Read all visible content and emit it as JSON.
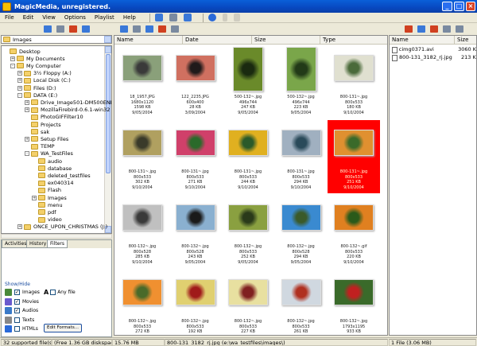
{
  "window": {
    "title": "MagicMedia, unregistered.",
    "buttons": [
      "_",
      "□",
      "×"
    ]
  },
  "menu": [
    "File",
    "Edit",
    "View",
    "Options",
    "Playlist",
    "Help"
  ],
  "left_panel": {
    "path": "Images",
    "tree": [
      {
        "label": "Desktop",
        "depth": 0,
        "exp": ""
      },
      {
        "label": "My Documents",
        "depth": 1,
        "exp": "+"
      },
      {
        "label": "My Computer",
        "depth": 1,
        "exp": "-"
      },
      {
        "label": "3½ Floppy (A:)",
        "depth": 2,
        "exp": "+"
      },
      {
        "label": "Local Disk (C:)",
        "depth": 2,
        "exp": "+"
      },
      {
        "label": "Files (D:)",
        "depth": 2,
        "exp": "+"
      },
      {
        "label": "DATA (E:)",
        "depth": 2,
        "exp": "-"
      },
      {
        "label": "Drive_Image501-DM500ENEU",
        "depth": 3,
        "exp": "+"
      },
      {
        "label": "MozillaFirebird-0.6.1-win32",
        "depth": 3,
        "exp": "+"
      },
      {
        "label": "PhotoGIFFilter10",
        "depth": 3,
        "exp": ""
      },
      {
        "label": "Projects",
        "depth": 3,
        "exp": ""
      },
      {
        "label": "sak",
        "depth": 3,
        "exp": ""
      },
      {
        "label": "Setup Files",
        "depth": 3,
        "exp": "+"
      },
      {
        "label": "TEMP",
        "depth": 3,
        "exp": ""
      },
      {
        "label": "WA_TestFiles",
        "depth": 3,
        "exp": "-"
      },
      {
        "label": "audio",
        "depth": 4,
        "exp": ""
      },
      {
        "label": "database",
        "depth": 4,
        "exp": ""
      },
      {
        "label": "deleted_testfiles",
        "depth": 4,
        "exp": ""
      },
      {
        "label": "ex040314",
        "depth": 4,
        "exp": ""
      },
      {
        "label": "Flash",
        "depth": 4,
        "exp": ""
      },
      {
        "label": "Images",
        "depth": 4,
        "exp": "+"
      },
      {
        "label": "menu",
        "depth": 4,
        "exp": ""
      },
      {
        "label": "pdf",
        "depth": 4,
        "exp": ""
      },
      {
        "label": "video",
        "depth": 4,
        "exp": ""
      },
      {
        "label": "ONCE_UPON_CHRISTMAS (J:)",
        "depth": 2,
        "exp": "+"
      }
    ],
    "tabs": [
      "Activities",
      "History",
      "Filters"
    ],
    "filters": {
      "heading": "Show/Hide",
      "items": [
        {
          "label": "Images",
          "checked": true,
          "color": "#4a8a3a"
        },
        {
          "label": "Movies",
          "checked": true,
          "color": "#6a5acd"
        },
        {
          "label": "Audios",
          "checked": true,
          "color": "#3a7ac8"
        },
        {
          "label": "Texts",
          "checked": false,
          "color": "#888888"
        },
        {
          "label": "HTMLs",
          "checked": false,
          "color": "#2a6ad8"
        }
      ],
      "anyfile": "Any file",
      "edit_button": "Edit Formats..."
    }
  },
  "center": {
    "columns": [
      "Name",
      "Date",
      "Size",
      "Type"
    ],
    "thumbs": [
      {
        "name": "18_1957.JPG",
        "dim": "1680x1120",
        "size": "1598 KB",
        "date": "9/05/2004",
        "c1": "#8aa07a",
        "c2": "#3a3a3a",
        "w": 50,
        "h": 33
      },
      {
        "name": "122_2235.JPG",
        "dim": "600x400",
        "size": "28 KB",
        "date": "3/09/2004",
        "c1": "#d07060",
        "c2": "#201a1a",
        "w": 50,
        "h": 33
      },
      {
        "name": "500-132~.jpg",
        "dim": "496x744",
        "size": "247 KB",
        "date": "9/05/2004",
        "c1": "#6a8a2a",
        "c2": "#1a2a10",
        "w": 38,
        "h": 56
      },
      {
        "name": "500-132~.jpg",
        "dim": "496x744",
        "size": "223 KB",
        "date": "9/05/2004",
        "c1": "#7aa64a",
        "c2": "#223a18",
        "w": 38,
        "h": 56
      },
      {
        "name": "800-131~.jpg",
        "dim": "800x533",
        "size": "180 KB",
        "date": "9/10/2004",
        "c1": "#e0e0d0",
        "c2": "#4a6a3a",
        "w": 50,
        "h": 33
      },
      {
        "name": "800-131~.jpg",
        "dim": "800x533",
        "size": "302 KB",
        "date": "9/10/2004",
        "c1": "#b0a060",
        "c2": "#3a3a2a",
        "w": 50,
        "h": 33
      },
      {
        "name": "800-131~.jpg",
        "dim": "800x533",
        "size": "271 KB",
        "date": "9/10/2004",
        "c1": "#d0406a",
        "c2": "#2a6a2a",
        "w": 50,
        "h": 33
      },
      {
        "name": "800-131~.jpg",
        "dim": "800x533",
        "size": "244 KB",
        "date": "9/10/2004",
        "c1": "#e0b020",
        "c2": "#2a5a2a",
        "w": 50,
        "h": 33
      },
      {
        "name": "800-131~.jpg",
        "dim": "800x533",
        "size": "294 KB",
        "date": "9/10/2004",
        "c1": "#a0b0c0",
        "c2": "#2a4a5a",
        "w": 50,
        "h": 33
      },
      {
        "name": "800-131~.jpg",
        "dim": "800x533",
        "size": "251 KB",
        "date": "9/10/2004",
        "c1": "#e09030",
        "c2": "#3a6a2a",
        "w": 50,
        "h": 33,
        "selected": true
      },
      {
        "name": "800-132~.jpg",
        "dim": "800x528",
        "size": "285 KB",
        "date": "9/10/2004",
        "c1": "#c0c0c0",
        "c2": "#3a3a3a",
        "w": 50,
        "h": 33
      },
      {
        "name": "800-132~.jpg",
        "dim": "800x528",
        "size": "243 KB",
        "date": "9/05/2004",
        "c1": "#8ab0d0",
        "c2": "#1a1a1a",
        "w": 50,
        "h": 33
      },
      {
        "name": "800-132~.jpg",
        "dim": "800x533",
        "size": "252 KB",
        "date": "9/05/2004",
        "c1": "#8aa040",
        "c2": "#2a3a1a",
        "w": 50,
        "h": 33
      },
      {
        "name": "800-132~.jpg",
        "dim": "800x528",
        "size": "294 KB",
        "date": "9/05/2004",
        "c1": "#3a8ad0",
        "c2": "#3a5a2a",
        "w": 50,
        "h": 33
      },
      {
        "name": "800-132~.gif",
        "dim": "800x533",
        "size": "220 KB",
        "date": "9/10/2004",
        "c1": "#e08020",
        "c2": "#2a5a1a",
        "w": 50,
        "h": 33
      },
      {
        "name": "800-132~.jpg",
        "dim": "800x533",
        "size": "272 KB",
        "date": "9/05/2004",
        "c1": "#f09030",
        "c2": "#4a6a2a",
        "w": 50,
        "h": 33
      },
      {
        "name": "800-132~.jpg",
        "dim": "800x533",
        "size": "192 KB",
        "date": "9/05/2004",
        "c1": "#e0d070",
        "c2": "#a01a1a",
        "w": 50,
        "h": 33
      },
      {
        "name": "800-132~.jpg",
        "dim": "800x533",
        "size": "227 KB",
        "date": "9/05/2004",
        "c1": "#e8e0a0",
        "c2": "#802020",
        "w": 50,
        "h": 33
      },
      {
        "name": "800-132~.jpg",
        "dim": "800x533",
        "size": "261 KB",
        "date": "9/05/2004",
        "c1": "#d0d8e0",
        "c2": "#b03020",
        "w": 50,
        "h": 33
      },
      {
        "name": "800-132~.jpg",
        "dim": "1793x1195",
        "size": "933 KB",
        "date": "9/05/2004",
        "c1": "#3a6a2a",
        "c2": "#c02020",
        "w": 50,
        "h": 33
      }
    ]
  },
  "right_panel": {
    "columns": [
      "Name",
      "Size"
    ],
    "files": [
      {
        "name": "cimg0371.avi",
        "size": "3060 K"
      },
      {
        "name": "800-131_3182_rj.jpg",
        "size": "213 K"
      }
    ]
  },
  "status": {
    "supported": "32 supported file(s)",
    "free": "(Free 1.36 GB diskspace)",
    "size": "15.76 MB",
    "path": "800-131_3182_rj.jpg (e:\\wa_testfiles\\images\\)",
    "files": "1 File (3.06 MB)"
  },
  "colors": {
    "selection": "#ff0000",
    "titlebar": "#0a52d0"
  }
}
